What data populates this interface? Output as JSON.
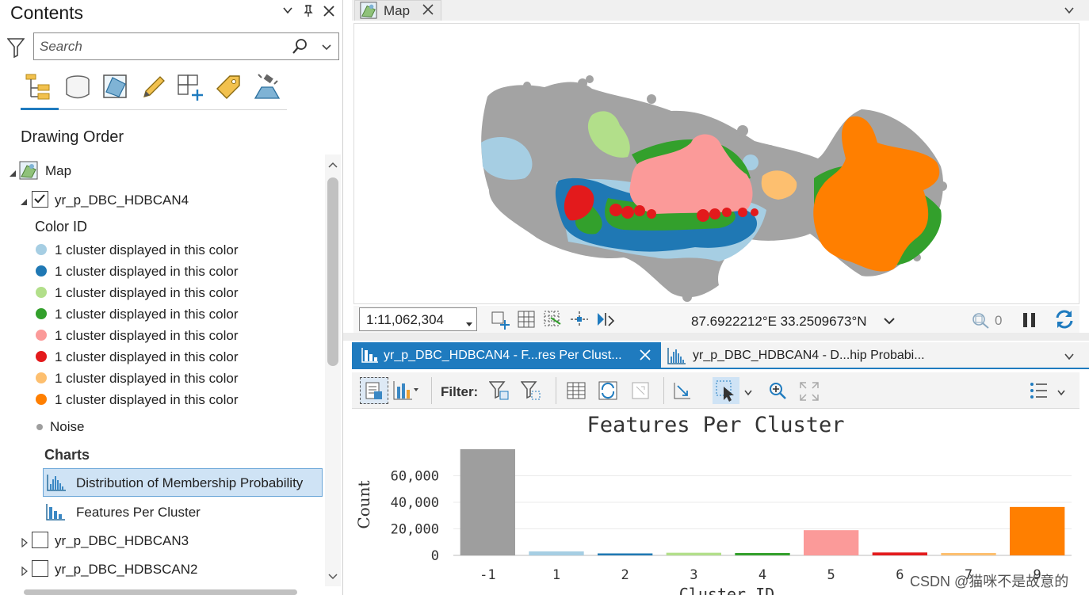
{
  "contents": {
    "title": "Contents",
    "search_placeholder": "Search",
    "drawing_order_label": "Drawing Order",
    "map_node_label": "Map",
    "active_layer_label": "yr_p_DBC_HDBCAN4",
    "color_id_label": "Color ID",
    "legend_items": [
      {
        "label": "1 cluster displayed in this color",
        "color": "#a6cee3"
      },
      {
        "label": "1 cluster displayed in this color",
        "color": "#1f78b4"
      },
      {
        "label": "1 cluster displayed in this color",
        "color": "#b2df8a"
      },
      {
        "label": "1 cluster displayed in this color",
        "color": "#33a02c"
      },
      {
        "label": "1 cluster displayed in this color",
        "color": "#fb9a99"
      },
      {
        "label": "1 cluster displayed in this color",
        "color": "#e31a1c"
      },
      {
        "label": "1 cluster displayed in this color",
        "color": "#fdbf6f"
      },
      {
        "label": "1 cluster displayed in this color",
        "color": "#ff7f00"
      }
    ],
    "noise_label": "Noise",
    "noise_color": "#9e9e9e",
    "charts_label": "Charts",
    "chart_items": [
      {
        "label": "Distribution of Membership Probability",
        "selected": true
      },
      {
        "label": "Features Per Cluster",
        "selected": false
      }
    ],
    "other_layers": [
      "yr_p_DBC_HDBCAN3",
      "yr_p_DBC_HDBSCAN2"
    ]
  },
  "map": {
    "tab_label": "Map",
    "scale": "1:11,062,304",
    "coordinates": "87.6922212°E 33.2509673°N",
    "selection_count": "0"
  },
  "chart_tabs": {
    "active": "yr_p_DBC_HDBCAN4 - F...res Per Clust...",
    "inactive": "yr_p_DBC_HDBCAN4 - D...hip Probabi..."
  },
  "chart_toolbar": {
    "filter_label": "Filter:"
  },
  "chart_data": {
    "type": "bar",
    "title": "Features Per Cluster",
    "ylabel": "Count",
    "xlabel": "Cluster ID",
    "categories": [
      "-1",
      "1",
      "2",
      "3",
      "4",
      "5",
      "6",
      "7",
      "9"
    ],
    "values": [
      80000,
      3000,
      1500,
      2000,
      1800,
      19000,
      2200,
      1800,
      36500
    ],
    "colors": [
      "#9e9e9e",
      "#a6cee3",
      "#1f78b4",
      "#b2df8a",
      "#33a02c",
      "#fb9a99",
      "#e31a1c",
      "#fdbf6f",
      "#ff7f00"
    ],
    "yticks": [
      "0",
      "20,000",
      "40,000",
      "60,000"
    ],
    "ytick_values": [
      0,
      20000,
      40000,
      60000
    ],
    "ylim": [
      0,
      80000
    ],
    "grid": true
  },
  "watermark": "CSDN @猫咪不是故意的"
}
